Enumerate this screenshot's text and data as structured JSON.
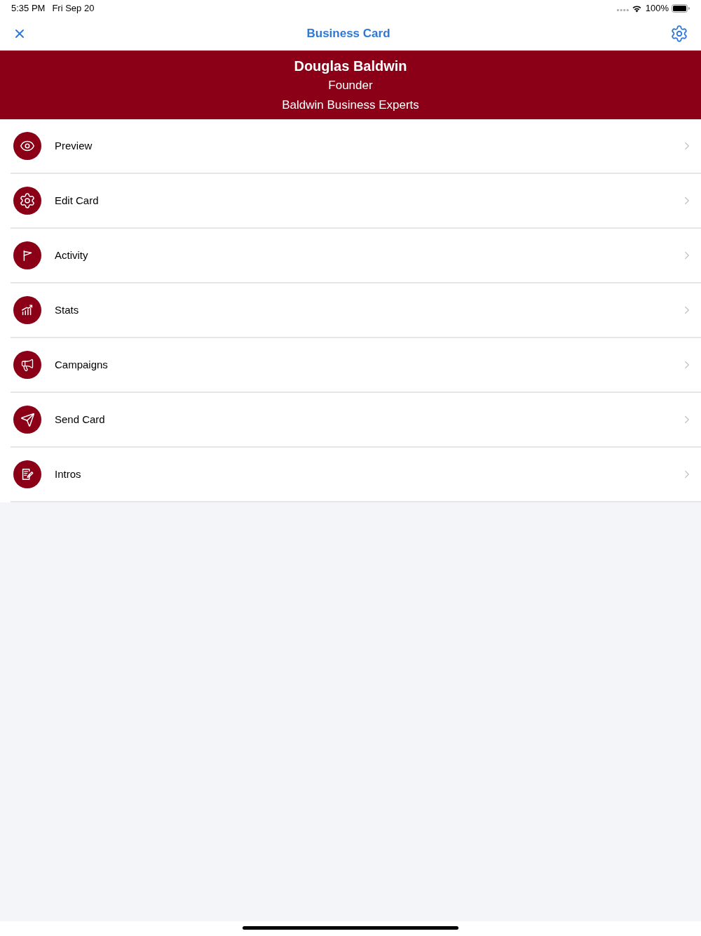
{
  "status_bar": {
    "time": "5:35 PM",
    "date": "Fri Sep 20",
    "battery": "100%"
  },
  "nav_bar": {
    "title": "Business Card"
  },
  "profile": {
    "name": "Douglas Baldwin",
    "role": "Founder",
    "company": "Baldwin Business Experts"
  },
  "menu": {
    "items": [
      {
        "label": "Preview"
      },
      {
        "label": "Edit Card"
      },
      {
        "label": "Activity"
      },
      {
        "label": "Stats"
      },
      {
        "label": "Campaigns"
      },
      {
        "label": "Send Card"
      },
      {
        "label": "Intros"
      }
    ]
  }
}
